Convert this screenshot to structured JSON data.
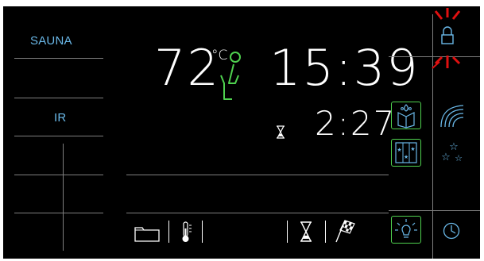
{
  "modes": {
    "sauna_label": "SAUNA",
    "ir_label": "IR"
  },
  "display": {
    "temperature": "72",
    "temperature_unit": "°C",
    "clock": "15:39",
    "timer": "2:27"
  },
  "icons": {
    "lock": "lock-icon",
    "seat": "person-seated-icon",
    "hourglass_small": "hourglass-icon",
    "folder": "folder-icon",
    "thermometer": "thermometer-icon",
    "hourglass_bottom": "hourglass-icon",
    "finish_flag": "checkered-flag-icon",
    "aroma": "aroma-book-icon",
    "fan_waves": "airflow-icon",
    "color_light": "colored-light-icon",
    "stars": "stars-icon",
    "light_bulb": "light-bulb-icon",
    "clock": "clock-icon"
  },
  "colors": {
    "background": "#000000",
    "accent_blue": "#6ab8e8",
    "accent_green": "#4fd14f",
    "alert_red": "#e01010",
    "divider": "#7f7f7f",
    "digits": "#ffffff"
  }
}
